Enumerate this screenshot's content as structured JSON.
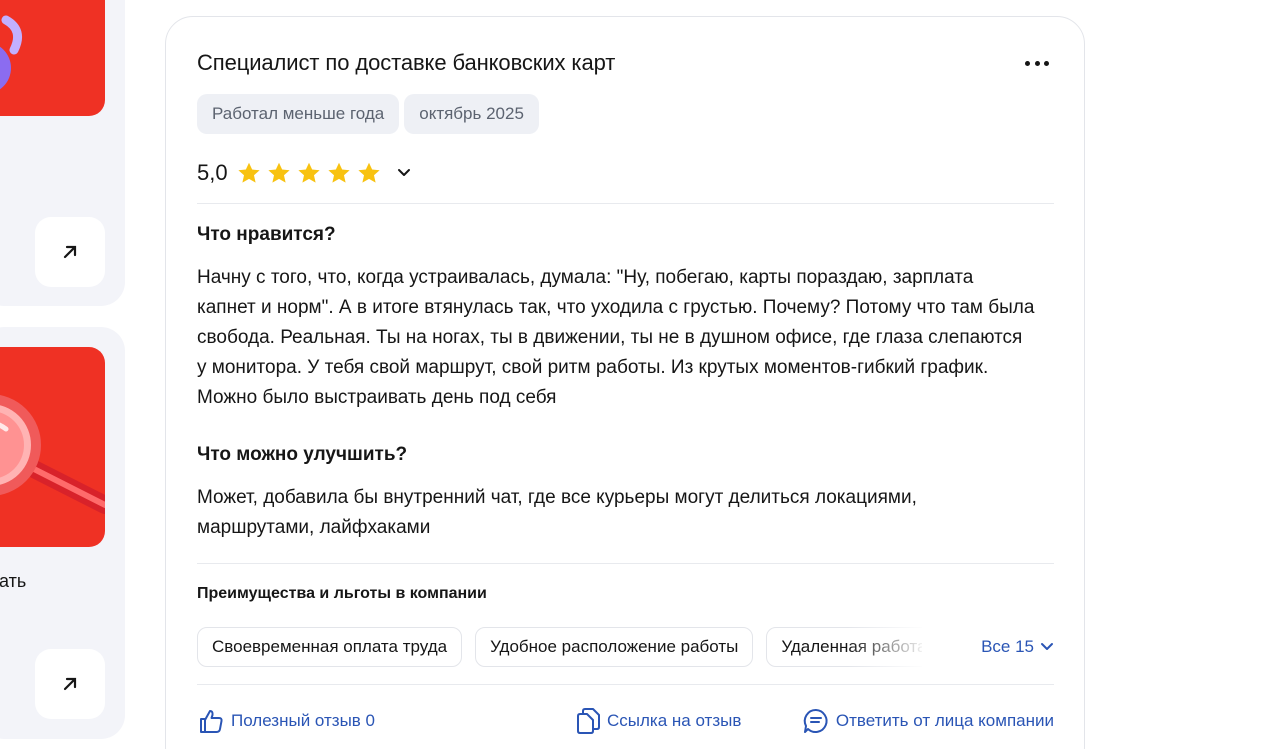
{
  "left_column": {
    "partial_text": "ачать"
  },
  "review": {
    "title": "Специалист по доставке банковских карт",
    "tags": [
      "Работал меньше года",
      "октябрь 2025"
    ],
    "rating_value": "5,0",
    "rating_stars": 5,
    "likes_heading": "Что нравится?",
    "likes_text": "Начну с того, что, когда устраивалась, думала: \"Ну, побегаю, карты пораздаю, зарплата капнет и норм\". А в итоге втянулась так, что уходила с грустью. Почему? Потому что там была свобода. Реальная. Ты на ногах, ты в движении, ты не в душном офисе, где глаза слепаются у монитора. У тебя свой маршрут, свой ритм работы. Из крутых моментов-гибкий график. Можно было выстраивать день под себя",
    "improve_heading": "Что можно улучшить?",
    "improve_text": "Может, добавила бы внутренний чат, где все курьеры могут делиться локациями, маршрутами, лайфхаками",
    "perks_heading": "Преимущества и льготы в компании",
    "perks": [
      "Своевременная оплата труда",
      "Удобное расположение работы",
      "Удаленная работа"
    ],
    "perks_all": "Все 15",
    "actions": {
      "helpful": "Полезный отзыв 0",
      "link": "Ссылка на отзыв",
      "reply": "Ответить от лица компании"
    }
  },
  "colors": {
    "accent_blue": "#2a55b5",
    "star": "#f8c211",
    "promo_red": "#ef3124",
    "tag_bg": "#eef0f5",
    "panel_bg": "#f3f4f9"
  }
}
